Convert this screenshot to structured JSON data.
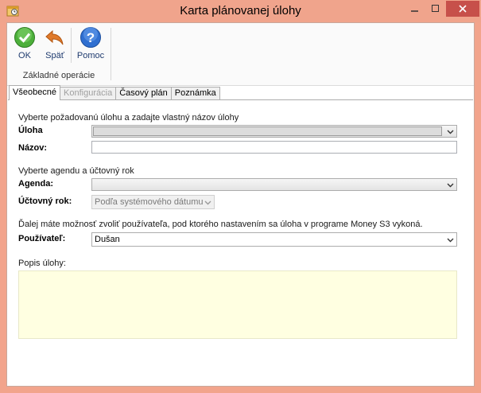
{
  "window": {
    "title": "Karta plánovanej úlohy",
    "colors": {
      "frame": "#f0a48c",
      "close_button": "#c7504a",
      "notes_bg": "#ffffe1"
    }
  },
  "toolbar": {
    "ok_label": "OK",
    "back_label": "Späť",
    "help_label": "Pomoc",
    "group_label": "Základné operácie"
  },
  "tabs": [
    {
      "label": "Všeobecné",
      "state": "active"
    },
    {
      "label": "Konfigurácia",
      "state": "disabled"
    },
    {
      "label": "Časový plán",
      "state": "normal"
    },
    {
      "label": "Poznámka",
      "state": "normal"
    }
  ],
  "general": {
    "task_section_text": "Vyberte požadovanú úlohu a zadajte vlastný názov úlohy",
    "task_label": "Úloha",
    "task_value": "",
    "name_label": "Názov:",
    "name_value": "",
    "agenda_section_text": "Vyberte agendu a účtovný rok",
    "agenda_label": "Agenda:",
    "agenda_value": "",
    "year_label": "Účtovný rok:",
    "year_value": "Podľa systémového dátumu",
    "user_section_text": "Ďalej máte  možnosť zvoliť používateľa, pod ktorého nastavením sa úloha v programe Money S3 vykoná.",
    "user_label": "Používateľ:",
    "user_value": "Dušan",
    "description_label": "Popis úlohy:",
    "description_value": ""
  },
  "icons": {
    "ok": "check-circle-icon",
    "back": "undo-arrow-icon",
    "help": "question-circle-icon",
    "dropdown": "chevron-down-icon"
  }
}
